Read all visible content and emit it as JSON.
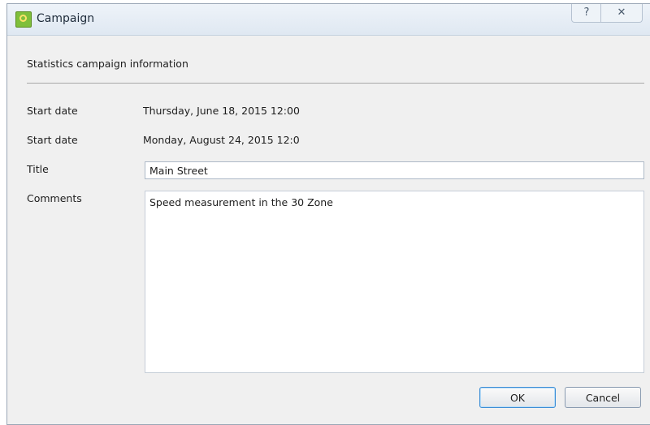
{
  "window": {
    "title": "Campaign",
    "help_glyph": "?",
    "close_glyph": "✕"
  },
  "form": {
    "header": "Statistics campaign information",
    "start_date_1": {
      "label": "Start date",
      "value": "Thursday, June 18, 2015 12:00"
    },
    "start_date_2": {
      "label": "Start date",
      "value": "Monday, August 24, 2015 12:0"
    },
    "title": {
      "label": "Title",
      "value": "Main Street"
    },
    "comments": {
      "label": "Comments",
      "value": "Speed measurement in the 30 Zone"
    }
  },
  "buttons": {
    "ok": "OK",
    "cancel": "Cancel"
  }
}
